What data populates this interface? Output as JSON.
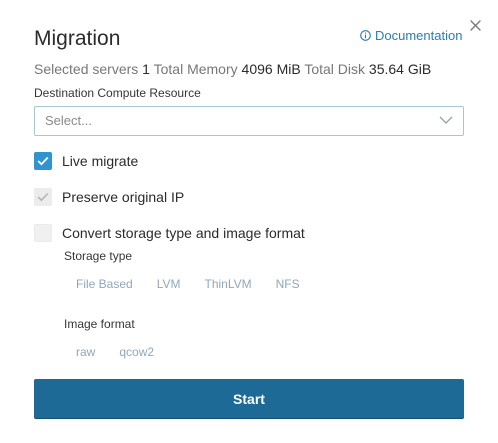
{
  "dialog": {
    "title": "Migration",
    "documentation_label": "Documentation",
    "close_icon": "close-icon",
    "info_icon": "info-circle-icon"
  },
  "summary": {
    "selected_label": "Selected servers",
    "selected_value": "1",
    "memory_label": "Total Memory",
    "memory_value": "4096 MiB",
    "disk_label": "Total Disk",
    "disk_value": "35.64 GiB"
  },
  "destination": {
    "label": "Destination Compute Resource",
    "placeholder": "Select..."
  },
  "options": {
    "live_migrate": {
      "label": "Live migrate",
      "checked": true
    },
    "preserve_ip": {
      "label": "Preserve original IP",
      "checked": true,
      "disabled": true
    },
    "convert_storage": {
      "label": "Convert storage type and image format",
      "checked": false
    }
  },
  "storage_type": {
    "label": "Storage type",
    "options": [
      "File Based",
      "LVM",
      "ThinLVM",
      "NFS"
    ]
  },
  "image_format": {
    "label": "Image format",
    "options": [
      "raw",
      "qcow2"
    ]
  },
  "actions": {
    "start_label": "Start"
  },
  "colors": {
    "accent": "#2f94d0",
    "primary_button": "#1d6a96",
    "link": "#2c7cb0",
    "disabled_chip": "#90a7bb"
  }
}
